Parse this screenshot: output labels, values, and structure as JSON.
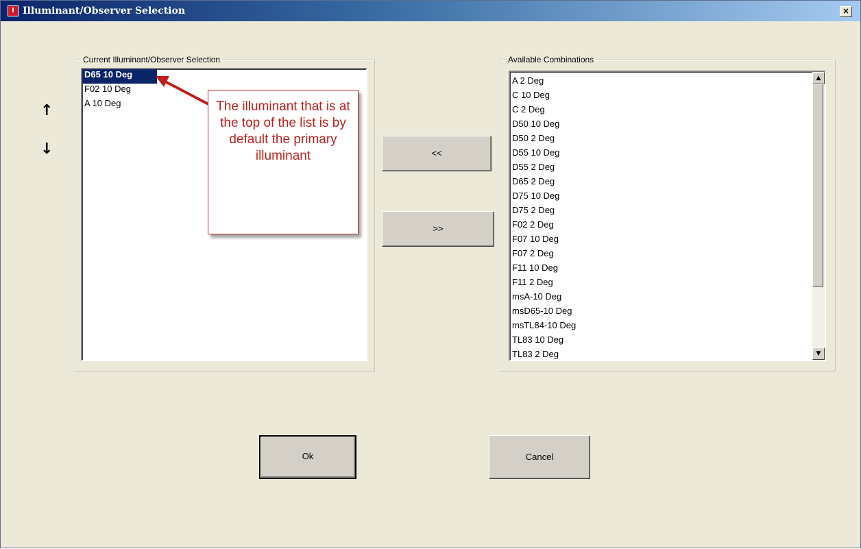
{
  "window": {
    "title": "Illuminant/Observer Selection",
    "app_icon_label": "I",
    "close_label": "×"
  },
  "current": {
    "legend": "Current Illuminant/Observer Selection",
    "items": [
      "D65 10 Deg",
      "F02 10 Deg",
      "A 10 Deg"
    ],
    "selected_index": 0
  },
  "available": {
    "legend": "Available Combinations",
    "items": [
      "A 2 Deg",
      "C 10 Deg",
      "C 2 Deg",
      "D50 10 Deg",
      "D50 2 Deg",
      "D55 10 Deg",
      "D55 2 Deg",
      "D65 2 Deg",
      "D75 10 Deg",
      "D75 2 Deg",
      "F02 2 Deg",
      "F07 10 Deg",
      "F07 2 Deg",
      "F11 10 Deg",
      "F11 2 Deg",
      "msA-10  Deg",
      "msD65-10  Deg",
      "msTL84-10  Deg",
      "TL83 10 Deg",
      "TL83 2 Deg"
    ]
  },
  "buttons": {
    "add_label": "<<",
    "remove_label": ">>",
    "ok_label": "Ok",
    "cancel_label": "Cancel",
    "move_up_icon": "↑",
    "move_down_icon": "↓"
  },
  "callout": {
    "text": "The illuminant that is at the top of the list is by default the primary illuminant",
    "color": "#c0201c"
  },
  "colors": {
    "selection": "#0a246a",
    "dialog_bg": "#ece9d8"
  }
}
